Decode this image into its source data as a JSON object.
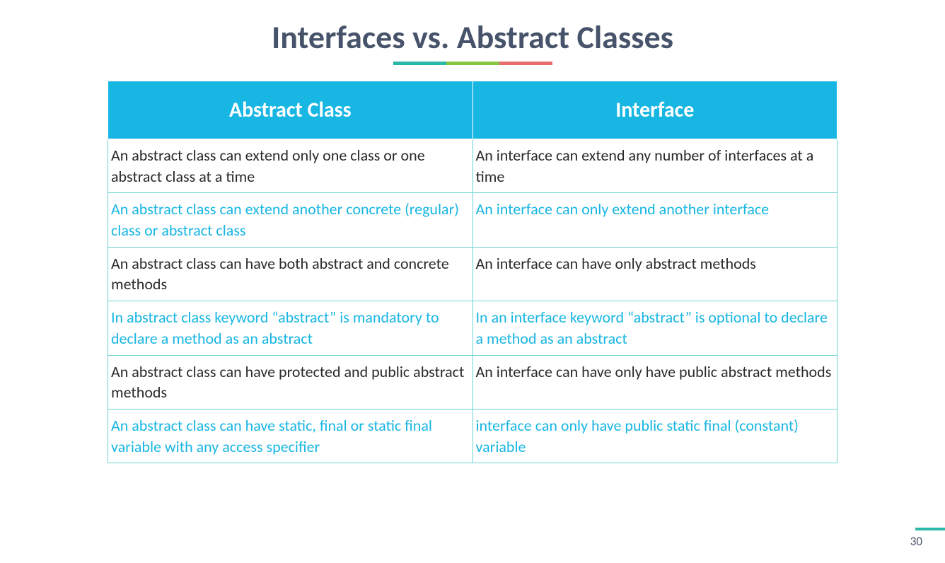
{
  "slide": {
    "title": "Interfaces vs. Abstract Classes",
    "table": {
      "headers": {
        "col1": "Abstract Class",
        "col2": "Interface"
      },
      "rows": [
        {
          "style": "dark",
          "col1": " An abstract class can extend only one class or one abstract class at a time",
          "col2": " An interface can extend any number of interfaces at a time"
        },
        {
          "style": "teal",
          "col1": "  An abstract class can extend another concrete (regular) class or abstract class",
          "col2": "  An interface can only extend another interface"
        },
        {
          "style": "dark",
          "col1": " An abstract class can have both abstract and concrete methods",
          "col2": " An interface can have only abstract methods"
        },
        {
          "style": "teal",
          "col1": " In abstract class keyword “abstract” is mandatory to declare a method as an abstract",
          "col2": " In an interface keyword “abstract” is optional to declare a method as an abstract"
        },
        {
          "style": "dark",
          "col1": " An abstract class can have protected and public abstract methods",
          "col2": " An interface can have only have public abstract methods"
        },
        {
          "style": "teal",
          "col1": " An abstract class can have static, final or static final variable with any access specifier",
          "col2": "  interface can only have public static final (constant) variable"
        }
      ]
    },
    "pageNumber": "30"
  }
}
